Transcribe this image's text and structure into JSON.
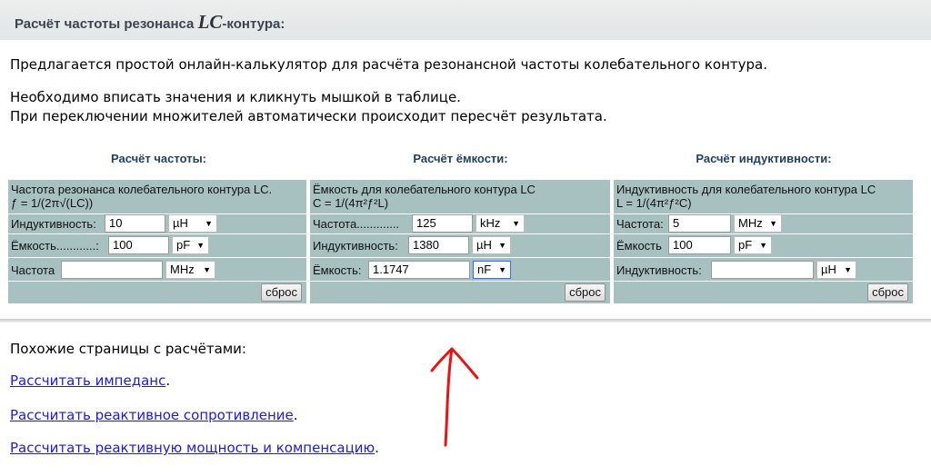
{
  "header": {
    "title_before": "Расчёт частоты резонанса ",
    "title_lc": "LC",
    "title_after": "-контура:"
  },
  "intro": {
    "line1": "Предлагается простой онлайн-калькулятор для расчёта резонансной частоты колебательного контура.",
    "line2": "Необходимо вписать значения и кликнуть мышкой в таблице.",
    "line3": "При переключении множителей автоматически происходит пересчёт результата."
  },
  "calculators": {
    "frequency": {
      "title": "Расчёт частоты:",
      "desc1": "Частота резонанса колебательного контура LC.",
      "desc2": "ƒ = 1/(2π√(LC))",
      "row1_label": "Индуктивность:",
      "row1_value": "10",
      "row1_unit": "µH",
      "row2_label": "Ёмкость............:",
      "row2_value": "100",
      "row2_unit": "pF",
      "row3_label": "Частота",
      "row3_value": "",
      "row3_unit": "MHz",
      "reset": "сброс"
    },
    "capacitance": {
      "title": "Расчёт ёмкости:",
      "desc1": "Ёмкость для колебательного контура LC",
      "desc2": "C = 1/(4π²ƒ²L)",
      "row1_label": "Частота.............",
      "row1_value": "125",
      "row1_unit": "kHz",
      "row2_label": "Индуктивность:",
      "row2_value": "1380",
      "row2_unit": "µH",
      "row3_label": "Ёмкость:",
      "row3_value": "1.1747",
      "row3_unit": "nF",
      "reset": "сброс"
    },
    "inductance": {
      "title": "Расчёт индуктивности:",
      "desc1": "Индуктивность для колебательного контура LC",
      "desc2": "L = 1/(4π²ƒ²C)",
      "row1_label": "Частота:",
      "row1_value": "5",
      "row1_unit": "MHz",
      "row2_label": "Ёмкость",
      "row2_value": "100",
      "row2_unit": "pF",
      "row3_label": "Индуктивность:",
      "row3_value": "",
      "row3_unit": "µH",
      "reset": "сброс"
    }
  },
  "similar": {
    "heading": "Похожие страницы с расчётами:",
    "links": [
      "Рассчитать импеданс",
      "Рассчитать реактивное сопротивление",
      "Рассчитать реактивную мощность и компенсацию"
    ],
    "period": "."
  },
  "icons": {
    "dropdown": "▼",
    "annotation_arrow": "red-hand-drawn-arrow"
  },
  "colors": {
    "table_bg": "#a7c0c0",
    "link": "#1a1aee",
    "title": "#1f3f5f",
    "arrow": "#ee1111"
  }
}
